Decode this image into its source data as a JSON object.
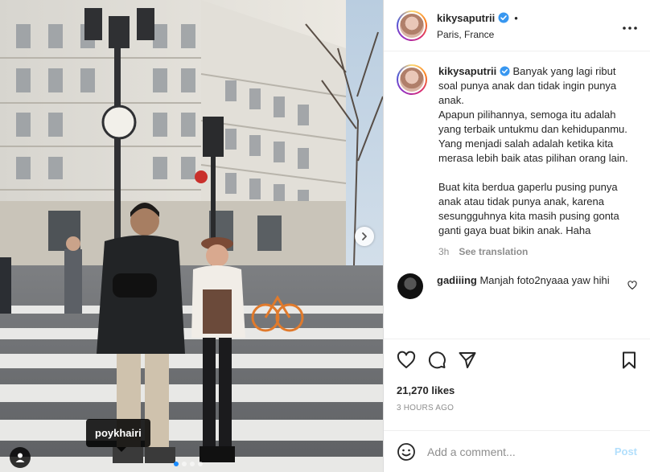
{
  "post": {
    "username": "kikysaputrii",
    "header_separator": "•",
    "location": "Paris, France",
    "verified": true
  },
  "photo": {
    "tag_label": "poykhairi",
    "carousel_count": 4,
    "carousel_active_index": 0
  },
  "caption": {
    "username": "kikysaputrii",
    "paragraph1": "Banyak yang lagi ribut soal punya anak dan tidak ingin punya anak.",
    "paragraph2": "Apapun pilihannya, semoga itu adalah yang terbaik untukmu dan kehidupanmu. Yang menjadi salah adalah ketika kita merasa lebih baik atas pilihan orang lain.",
    "paragraph3": "Buat kita berdua gaperlu pusing punya anak atau tidak punya anak, karena sesungguhnya kita masih pusing gonta ganti gaya buat bikin anak. Haha",
    "age": "3h",
    "see_translation": "See translation"
  },
  "comments": [
    {
      "username": "gadiiing",
      "text": "Manjah foto2nyaaa yaw hihi"
    }
  ],
  "engagement": {
    "likes": "21,270 likes",
    "timestamp": "3 HOURS AGO"
  },
  "composer": {
    "placeholder": "Add a comment...",
    "post_label": "Post"
  },
  "icons": {
    "more": "more-options-icon",
    "like": "heart-icon",
    "comment": "comment-icon",
    "share": "share-icon",
    "save": "bookmark-icon",
    "emoji": "emoji-icon",
    "verified": "verified-badge-icon",
    "next": "chevron-right-icon",
    "user_tag": "user-tag-icon"
  },
  "colors": {
    "verified": "#3897f0",
    "post_button": "#b2dffc",
    "muted": "#8e8e8e",
    "carousel_active": "#1a8cff"
  }
}
